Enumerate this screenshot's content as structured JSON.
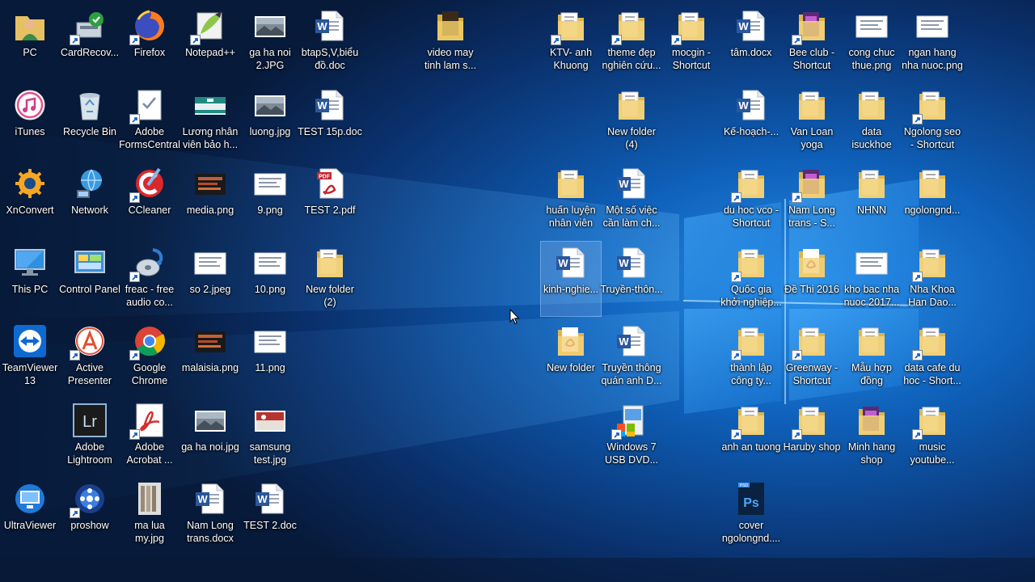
{
  "desktop": {
    "icons": [
      {
        "label": "PC",
        "type": "user",
        "shortcut": false
      },
      {
        "label": "CardRecov...",
        "type": "cardrecover",
        "shortcut": true
      },
      {
        "label": "Firefox",
        "type": "firefox",
        "shortcut": true
      },
      {
        "label": "Notepad++",
        "type": "notepadpp",
        "shortcut": true
      },
      {
        "label": "ga ha noi\n2.JPG",
        "type": "image",
        "shortcut": false
      },
      {
        "label": "btapS,V,biểu\nđồ.doc",
        "type": "word",
        "shortcut": false
      },
      {
        "label": "video may\ntinh lam s...",
        "type": "folder-dark",
        "shortcut": false
      },
      {
        "label": "KTV- anh\nKhuong",
        "type": "folder",
        "shortcut": true
      },
      {
        "label": "theme đẹp\nnghiên cứu...",
        "type": "folder",
        "shortcut": true
      },
      {
        "label": "mocgin -\nShortcut",
        "type": "folder",
        "shortcut": true
      },
      {
        "label": "tâm.docx",
        "type": "word",
        "shortcut": false
      },
      {
        "label": "Bee club -\nShortcut",
        "type": "folder-purple",
        "shortcut": true
      },
      {
        "label": "cong chuc\nthue.png",
        "type": "image-doc",
        "shortcut": false
      },
      {
        "label": "ngan hang\nnha nuoc.png",
        "type": "image-doc",
        "shortcut": false
      },
      {
        "label": "iTunes",
        "type": "itunes",
        "shortcut": false
      },
      {
        "label": "Recycle Bin",
        "type": "recycle",
        "shortcut": false
      },
      {
        "label": "Adobe\nFormsCentral",
        "type": "forms",
        "shortcut": true
      },
      {
        "label": "Lương nhân\nviên bảo h...",
        "type": "image-teal",
        "shortcut": false
      },
      {
        "label": "luong.jpg",
        "type": "image",
        "shortcut": false
      },
      {
        "label": "TEST 15p.doc",
        "type": "word",
        "shortcut": false
      },
      {
        "label": "New folder\n(4)",
        "type": "folder",
        "shortcut": false
      },
      {
        "label": "Kế-hoạch-...",
        "type": "word",
        "shortcut": false
      },
      {
        "label": "Van Loan\nyoga",
        "type": "folder",
        "shortcut": false
      },
      {
        "label": "data\nisuckhoe",
        "type": "folder",
        "shortcut": false
      },
      {
        "label": "Ngolong seo\n- Shortcut",
        "type": "folder",
        "shortcut": true
      },
      {
        "label": "XnConvert",
        "type": "xnconvert",
        "shortcut": false
      },
      {
        "label": "Network",
        "type": "network",
        "shortcut": false
      },
      {
        "label": "CCleaner",
        "type": "ccleaner",
        "shortcut": true
      },
      {
        "label": "media.png",
        "type": "image-dark",
        "shortcut": false
      },
      {
        "label": "9.png",
        "type": "image-doc",
        "shortcut": false
      },
      {
        "label": "TEST 2.pdf",
        "type": "pdf",
        "shortcut": false
      },
      {
        "label": "huấn luyện\nnhân viên",
        "type": "folder",
        "shortcut": false
      },
      {
        "label": "Một số việc\ncần làm ch...",
        "type": "word",
        "shortcut": false
      },
      {
        "label": "du hoc vco -\nShortcut",
        "type": "folder",
        "shortcut": true
      },
      {
        "label": "Nam Long\ntrans - S...",
        "type": "folder-purple",
        "shortcut": true
      },
      {
        "label": "NHNN",
        "type": "folder",
        "shortcut": false
      },
      {
        "label": "ngolongnd...",
        "type": "folder",
        "shortcut": false
      },
      {
        "label": "This PC",
        "type": "thispc",
        "shortcut": false
      },
      {
        "label": "Control Panel",
        "type": "controlpanel",
        "shortcut": false
      },
      {
        "label": "freac - free\naudio co...",
        "type": "freac",
        "shortcut": true
      },
      {
        "label": "so 2.jpeg",
        "type": "image-doc",
        "shortcut": false
      },
      {
        "label": "10.png",
        "type": "image-doc",
        "shortcut": false
      },
      {
        "label": "New folder\n(2)",
        "type": "folder",
        "shortcut": false
      },
      {
        "label": "kinh-nghie...",
        "type": "word",
        "shortcut": false,
        "selected": true
      },
      {
        "label": "Truyền-thôn...",
        "type": "word",
        "shortcut": false
      },
      {
        "label": "Quốc gia\nkhởi nghiệp...",
        "type": "folder",
        "shortcut": true
      },
      {
        "label": "Đề Thi  2016",
        "type": "folder-pdf",
        "shortcut": false
      },
      {
        "label": "kho bac nha\nnuoc 2017...",
        "type": "image-doc",
        "shortcut": false
      },
      {
        "label": "Nha Khoa\nHan Dao...",
        "type": "folder",
        "shortcut": true
      },
      {
        "label": "TeamViewer\n13",
        "type": "teamviewer",
        "shortcut": false
      },
      {
        "label": "Active\nPresenter",
        "type": "activepresenter",
        "shortcut": true
      },
      {
        "label": "Google\nChrome",
        "type": "chrome",
        "shortcut": true
      },
      {
        "label": "malaisia.png",
        "type": "image-dark",
        "shortcut": false
      },
      {
        "label": "11.png",
        "type": "image-doc",
        "shortcut": false
      },
      {
        "label": "New folder",
        "type": "folder-pdf",
        "shortcut": false
      },
      {
        "label": "Truyền thông\nquán anh D...",
        "type": "word",
        "shortcut": false
      },
      {
        "label": "thành lập\ncông ty...",
        "type": "folder",
        "shortcut": true
      },
      {
        "label": "Greenway -\nShortcut",
        "type": "folder",
        "shortcut": true
      },
      {
        "label": "Mẫu hợp\nđồng",
        "type": "folder",
        "shortcut": false
      },
      {
        "label": "data cafe du\nhoc - Short...",
        "type": "folder",
        "shortcut": true
      },
      {
        "label": "Adobe\nLightroom",
        "type": "lightroom",
        "shortcut": false
      },
      {
        "label": "Adobe\nAcrobat ...",
        "type": "acrobat",
        "shortcut": true
      },
      {
        "label": "ga ha noi.jpg",
        "type": "image",
        "shortcut": false
      },
      {
        "label": "samsung\ntest.jpg",
        "type": "image-red",
        "shortcut": false
      },
      {
        "label": "Windows 7\nUSB DVD...",
        "type": "win7usb",
        "shortcut": true
      },
      {
        "label": "anh an tuong",
        "type": "folder",
        "shortcut": true
      },
      {
        "label": "Haruby shop",
        "type": "folder",
        "shortcut": true
      },
      {
        "label": "Minh hang\nshop",
        "type": "folder-purple",
        "shortcut": false
      },
      {
        "label": "music\nyoutube...",
        "type": "folder",
        "shortcut": true
      },
      {
        "label": "UltraViewer",
        "type": "ultraviewer",
        "shortcut": false
      },
      {
        "label": "proshow",
        "type": "proshow",
        "shortcut": true
      },
      {
        "label": "ma lua\nmy.jpg",
        "type": "image-tall",
        "shortcut": false
      },
      {
        "label": "Nam Long\ntrans.docx",
        "type": "word",
        "shortcut": false
      },
      {
        "label": "TEST 2.doc",
        "type": "word",
        "shortcut": false
      },
      {
        "label": "cover\nngolongnd....",
        "type": "psd",
        "shortcut": false
      }
    ]
  },
  "colors": {
    "wallpaper_dark": "#061633",
    "wallpaper_blue": "#0f66c2",
    "light_beam": "#7cc8ff",
    "selection": "#9bc2f0"
  }
}
